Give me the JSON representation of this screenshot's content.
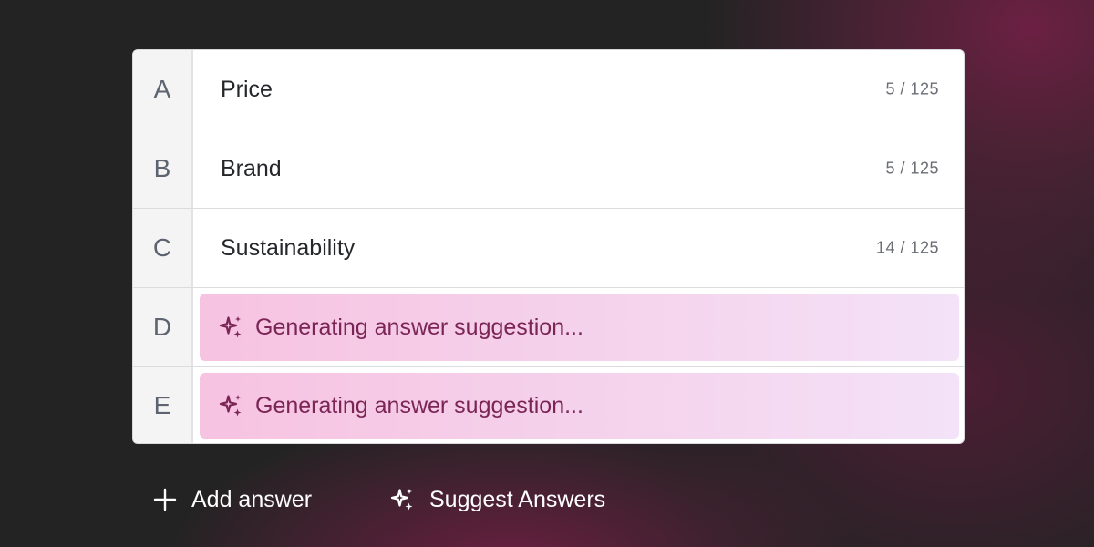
{
  "answers": [
    {
      "letter": "A",
      "text": "Price",
      "count": "5 / 125"
    },
    {
      "letter": "B",
      "text": "Brand",
      "count": "5 / 125"
    },
    {
      "letter": "C",
      "text": "Sustainability",
      "count": "14 / 125"
    },
    {
      "letter": "D",
      "status": "Generating answer suggestion..."
    },
    {
      "letter": "E",
      "status": "Generating answer suggestion..."
    }
  ],
  "actions": {
    "add_label": "Add answer",
    "add_icon": "plus-icon",
    "suggest_label": "Suggest Answers",
    "suggest_icon": "sparkles-icon"
  },
  "colors": {
    "background": "#232323",
    "accent": "#7b2556",
    "generating_fill": "#f6c3e1"
  }
}
